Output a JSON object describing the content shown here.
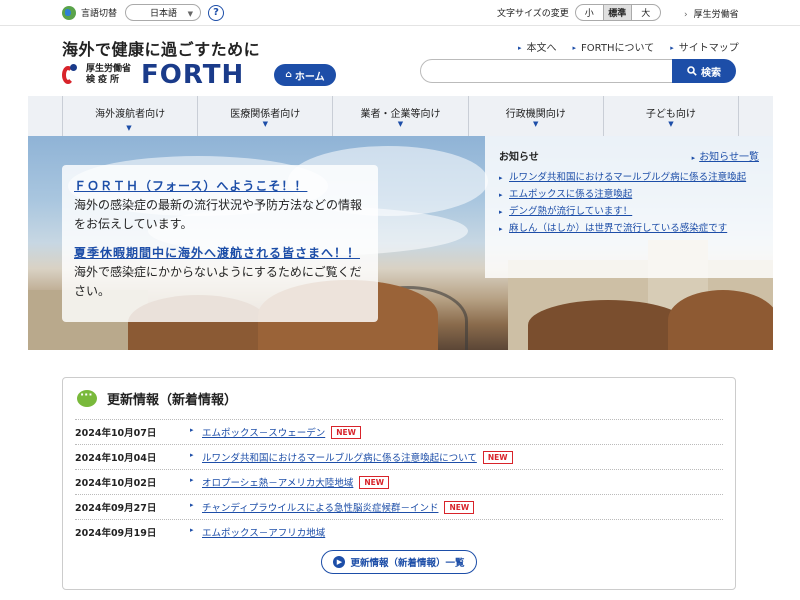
{
  "utility": {
    "lang_label": "言語切替",
    "lang_value": "日本語",
    "help_label": "?",
    "fontsize_label": "文字サイズの変更",
    "fontsize_options": [
      "小",
      "標準",
      "大"
    ],
    "mhlw_link": "厚生労働省"
  },
  "header": {
    "tagline": "海外で健康に過ごすために",
    "logo_org_line1": "厚生労働省",
    "logo_org_line2": "検疫所",
    "logo_name": "FORTH",
    "home_label": "ホーム",
    "toplinks": [
      "本文へ",
      "FORTHについて",
      "サイトマップ"
    ],
    "search_placeholder": "",
    "search_button": "検索"
  },
  "nav": [
    "海外渡航者向け",
    "医療関係者向け",
    "業者・企業等向け",
    "行政機関向け",
    "子ども向け"
  ],
  "hero": {
    "welcome_heading": "ＦＯＲＴＨ（フォース）へようこそ！！",
    "welcome_text": "海外の感染症の最新の流行状況や予防方法などの情報をお伝えしています。",
    "summer_heading": "夏季休暇期間中に海外へ渡航される皆さまへ！！",
    "summer_text": "海外で感染症にかからないようにするためにご覧ください。"
  },
  "notices": {
    "title": "お知らせ",
    "more": "お知らせ一覧",
    "items": [
      "ルワンダ共和国におけるマールブルグ病に係る注意喚起",
      "エムポックスに係る注意喚起",
      "デング熱が流行しています！",
      "麻しん（はしか）は世界で流行している感染症です"
    ]
  },
  "updates": {
    "title": "更新情報（新着情報）",
    "new_badge": "NEW",
    "rows": [
      {
        "date": "2024年10月07日",
        "title": "エムポックス－スウェーデン",
        "new": true
      },
      {
        "date": "2024年10月04日",
        "title": "ルワンダ共和国におけるマールブルグ病に係る注意喚起について",
        "new": true
      },
      {
        "date": "2024年10月02日",
        "title": "オロプーシェ熱－アメリカ大陸地域",
        "new": true
      },
      {
        "date": "2024年09月27日",
        "title": "チャンディプラウイルスによる急性脳炎症候群－インド",
        "new": true
      },
      {
        "date": "2024年09月19日",
        "title": "エムポックス－アフリカ地域",
        "new": false
      }
    ],
    "list_button": "更新情報（新着情報）一覧"
  }
}
